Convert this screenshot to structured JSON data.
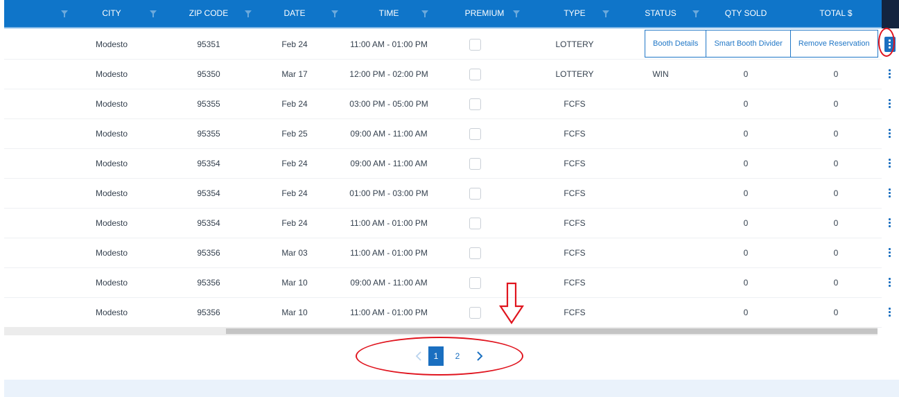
{
  "columns": [
    {
      "label": "CITY",
      "filter": true
    },
    {
      "label": "ZIP CODE",
      "filter": true
    },
    {
      "label": "DATE",
      "filter": true
    },
    {
      "label": "TIME",
      "filter": true
    },
    {
      "label": "PREMIUM",
      "filter": true
    },
    {
      "label": "TYPE",
      "filter": true
    },
    {
      "label": "STATUS",
      "filter": true
    },
    {
      "label": "QTY SOLD",
      "filter": false
    },
    {
      "label": "TOTAL $",
      "filter": false
    }
  ],
  "rows": [
    {
      "city": "Modesto",
      "zip": "95351",
      "date": "Feb 24",
      "time": "11:00 AM - 01:00 PM",
      "type": "LOTTERY",
      "status": "",
      "qty": "",
      "total": ""
    },
    {
      "city": "Modesto",
      "zip": "95350",
      "date": "Mar 17",
      "time": "12:00 PM - 02:00 PM",
      "type": "LOTTERY",
      "status": "WIN",
      "qty": "0",
      "total": "0"
    },
    {
      "city": "Modesto",
      "zip": "95355",
      "date": "Feb 24",
      "time": "03:00 PM - 05:00 PM",
      "type": "FCFS",
      "status": "",
      "qty": "0",
      "total": "0"
    },
    {
      "city": "Modesto",
      "zip": "95355",
      "date": "Feb 25",
      "time": "09:00 AM - 11:00 AM",
      "type": "FCFS",
      "status": "",
      "qty": "0",
      "total": "0"
    },
    {
      "city": "Modesto",
      "zip": "95354",
      "date": "Feb 24",
      "time": "09:00 AM - 11:00 AM",
      "type": "FCFS",
      "status": "",
      "qty": "0",
      "total": "0"
    },
    {
      "city": "Modesto",
      "zip": "95354",
      "date": "Feb 24",
      "time": "01:00 PM - 03:00 PM",
      "type": "FCFS",
      "status": "",
      "qty": "0",
      "total": "0"
    },
    {
      "city": "Modesto",
      "zip": "95354",
      "date": "Feb 24",
      "time": "11:00 AM - 01:00 PM",
      "type": "FCFS",
      "status": "",
      "qty": "0",
      "total": "0"
    },
    {
      "city": "Modesto",
      "zip": "95356",
      "date": "Mar 03",
      "time": "11:00 AM - 01:00 PM",
      "type": "FCFS",
      "status": "",
      "qty": "0",
      "total": "0"
    },
    {
      "city": "Modesto",
      "zip": "95356",
      "date": "Mar 10",
      "time": "09:00 AM - 11:00 AM",
      "type": "FCFS",
      "status": "",
      "qty": "0",
      "total": "0"
    },
    {
      "city": "Modesto",
      "zip": "95356",
      "date": "Mar 10",
      "time": "11:00 AM - 01:00 PM",
      "type": "FCFS",
      "status": "",
      "qty": "0",
      "total": "0"
    }
  ],
  "row_actions": {
    "booth_details": "Booth Details",
    "smart_booth_divider": "Smart Booth Divider",
    "remove_reservation": "Remove Reservation"
  },
  "pagination": {
    "pages": [
      "1",
      "2"
    ],
    "current_page": "1"
  },
  "colors": {
    "header_bg": "#0f75c9",
    "header_end": "#13243f",
    "accent": "#1a6fc0",
    "annotation": "#e0141e"
  },
  "icons": {
    "filter": "funnel-icon",
    "row_menu": "kebab-vertical-icon",
    "prev": "chevron-left-icon",
    "next": "chevron-right-icon",
    "annotation_arrow": "down-arrow-icon"
  }
}
